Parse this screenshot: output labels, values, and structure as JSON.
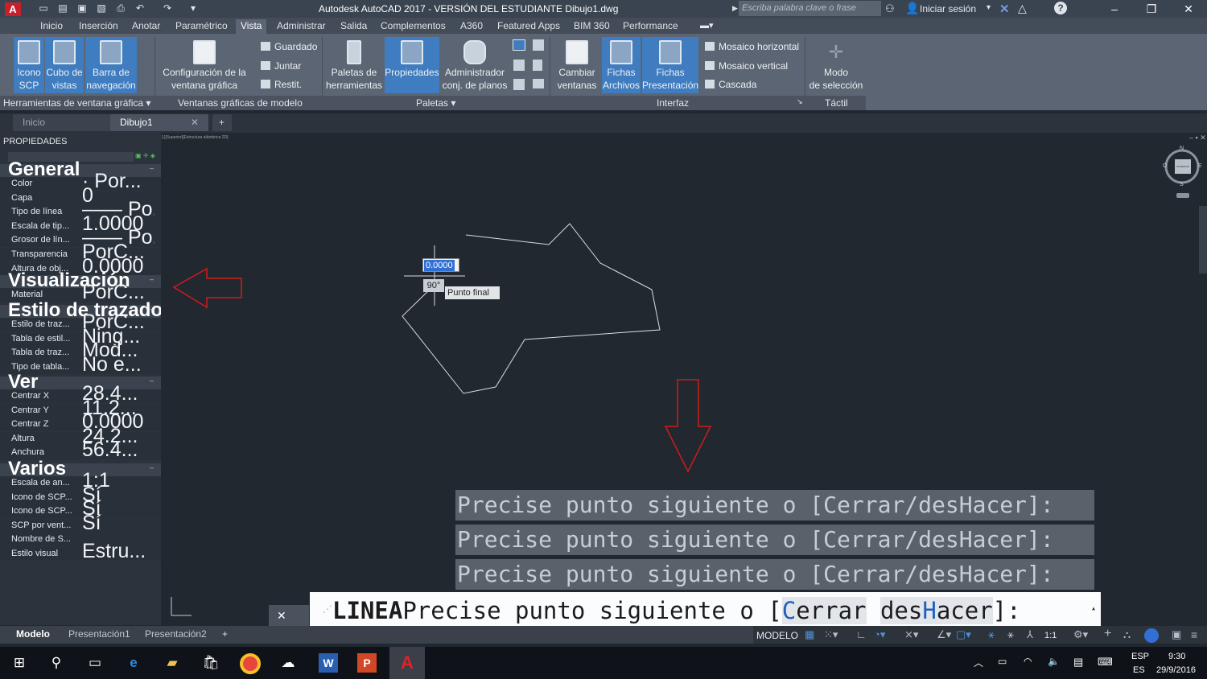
{
  "window": {
    "title": "Autodesk AutoCAD 2017 -  VERSIÓN DEL ESTUDIANTE    Dibujo1.dwg",
    "search_placeholder": "Escriba palabra clave o frase",
    "signin": "Iniciar sesión",
    "app_letter": "A"
  },
  "ribbon_tabs": [
    "Inicio",
    "Inserción",
    "Anotar",
    "Paramétrico",
    "Vista",
    "Administrar",
    "Salida",
    "Complementos",
    "A360",
    "Featured Apps",
    "BIM 360",
    "Performance"
  ],
  "ribbon": {
    "viewport_tools": {
      "ucs_icon": "Icono\nSCP",
      "view_cube": "Cubo de\nvistas",
      "nav_bar": "Barra de\nnavegación",
      "label": "Herramientas de ventana gráfica"
    },
    "model_viewports": {
      "config": "Configuración de la\nventana gráfica",
      "save": "Guardado",
      "join": "Juntar",
      "restore": "Restit.",
      "label": "Ventanas gráficas de modelo"
    },
    "palettes": {
      "tool_palettes": "Paletas de\nherramientas",
      "properties": "Propiedades",
      "sheet_set": "Administrador\nconj. de planos",
      "label": "Paletas"
    },
    "interface": {
      "switch": "Cambiar\nventanas",
      "file_tabs": "Fichas\nArchivos",
      "layout_tabs": "Fichas\nPresentación",
      "tile_h": "Mosaico horizontal",
      "tile_v": "Mosaico vertical",
      "cascade": "Cascada",
      "label": "Interfaz"
    },
    "touch": {
      "select_mode": "Modo\nde selección",
      "label": "Táctil"
    }
  },
  "doc_tabs": {
    "home": "Inicio",
    "drawing": "Dibujo1",
    "new": "+"
  },
  "properties": {
    "title": "PROPIEDADES",
    "rows": [
      {
        "type": "section",
        "text": "General"
      },
      {
        "label": "Color",
        "value": "· Por..."
      },
      {
        "label": "Capa",
        "value": "0"
      },
      {
        "label": "Tipo de línea",
        "value": "—— Po..."
      },
      {
        "label": "Escala de tip...",
        "value": "1.0000"
      },
      {
        "label": "Grosor de lín...",
        "value": "—— Po..."
      },
      {
        "label": "Transparencia",
        "value": "PorC..."
      },
      {
        "label": "Altura de obj...",
        "value": "0.0000"
      },
      {
        "type": "section",
        "text": "Visualización"
      },
      {
        "label": "Material",
        "value": "PorC..."
      },
      {
        "type": "section",
        "text": "Estilo de trazado"
      },
      {
        "label": "Estilo de traz...",
        "value": "PorC..."
      },
      {
        "label": "Tabla de estil...",
        "value": "Ning..."
      },
      {
        "label": "Tabla de traz...",
        "value": "Mod..."
      },
      {
        "label": "Tipo de tabla...",
        "value": "No e..."
      },
      {
        "type": "section",
        "text": "Ver"
      },
      {
        "label": "Centrar X",
        "value": "28.4..."
      },
      {
        "label": "Centrar Y",
        "value": "11.2..."
      },
      {
        "label": "Centrar Z",
        "value": "0.0000"
      },
      {
        "label": "Altura",
        "value": "24.2..."
      },
      {
        "label": "Anchura",
        "value": "56.4..."
      },
      {
        "type": "section",
        "text": "Varios"
      },
      {
        "label": "Escala de an...",
        "value": "1:1"
      },
      {
        "label": "Icono de SCP...",
        "value": "Sí"
      },
      {
        "label": "Icono de SCP...",
        "value": "Sí"
      },
      {
        "label": "SCP por vent...",
        "value": "Sí"
      },
      {
        "label": "Nombre de S...",
        "value": ""
      },
      {
        "label": "Estilo visual",
        "value": "Estru..."
      }
    ]
  },
  "canvas": {
    "view_label": "[-][Superior][Estructura alámbrica 2D]",
    "dyn_input": "0.0000",
    "angle": "90°",
    "tooltip": "Punto final",
    "compass": {
      "n": "N",
      "s": "S",
      "e": "E",
      "w": "O",
      "cube": "SUPERIOR"
    }
  },
  "command": {
    "history": [
      "Precise punto siguiente o [Cerrar/desHacer]:",
      "Precise punto siguiente o [Cerrar/desHacer]:",
      "Precise punto siguiente o [Cerrar/desHacer]:"
    ],
    "cmd": "LINEA",
    "prompt": "Precise punto siguiente o [",
    "opt1_a": "C",
    "opt1_b": "errar",
    "opt2_a": "des",
    "opt2_b": "H",
    "opt2_c": "acer",
    "end": "]:"
  },
  "layout_tabs": [
    "Modelo",
    "Presentación1",
    "Presentación2",
    "+"
  ],
  "status": {
    "model": "MODELO",
    "scale": "1:1"
  },
  "taskbar": {
    "lang1": "ESP",
    "lang2": "ES",
    "time": "9:30",
    "date": "29/9/2016"
  },
  "colors": {
    "accent": "#3f7cc0",
    "annotation_arrow": "#d11a1a",
    "linework": "#d8dde3"
  }
}
